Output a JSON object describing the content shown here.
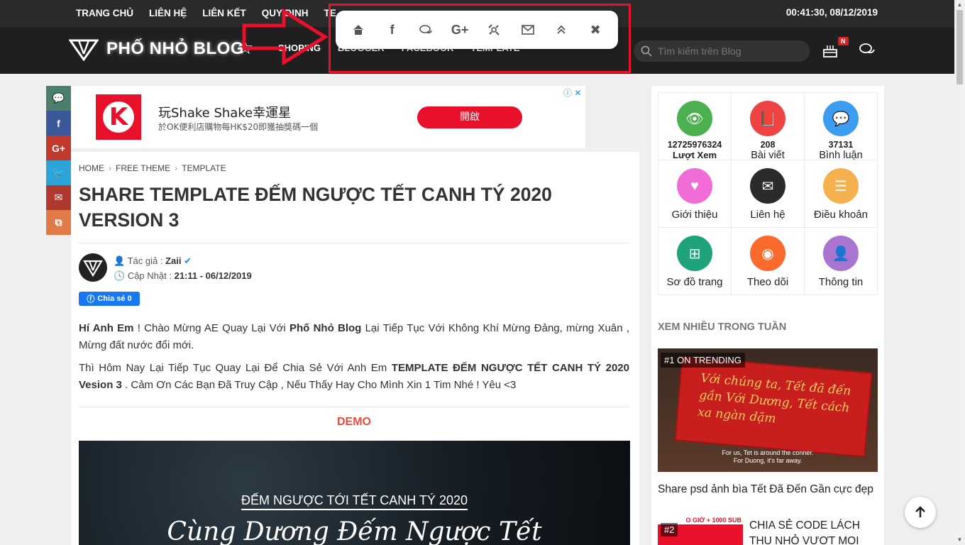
{
  "topnav": [
    "TRANG CHỦ",
    "LIÊN HỆ",
    "LIÊN KẾT",
    "QUY ĐỊNH",
    "TE"
  ],
  "clock": "00:41:30, 08/12/2019",
  "logo_text": "PHỐ NHỎ BLOG",
  "mainnav": [
    "SHOPING",
    "BLOGGER",
    "FACEBOOK",
    "TEMPLATE"
  ],
  "search_placeholder": "Tìm kiếm trên Blog",
  "notif_badge": "N",
  "side_share": [
    {
      "icon": "comment-icon",
      "glyph": "💬",
      "color": "#4a7f6b"
    },
    {
      "icon": "facebook-icon",
      "glyph": "f",
      "color": "#3b5998"
    },
    {
      "icon": "google-plus-icon",
      "glyph": "G+",
      "color": "#c0392b"
    },
    {
      "icon": "twitter-icon",
      "glyph": "🐦",
      "color": "#2da4d8"
    },
    {
      "icon": "mail-icon",
      "glyph": "✉",
      "color": "#b0392f"
    },
    {
      "icon": "copy-icon",
      "glyph": "⧉",
      "color": "#e07a48"
    }
  ],
  "ad": {
    "title": "玩Shake Shake幸運星",
    "subtitle": "於OK便利店購物每HK$20即獲抽獎碼一個",
    "button": "開啟",
    "logo_letter": "K"
  },
  "breadcrumb": [
    "HOME",
    "FREE THEME",
    "TEMPLATE"
  ],
  "article_title": "SHARE TEMPLATE ĐẾM NGƯỢC TẾT CANH TÝ 2020 VERSION 3",
  "author_label": "Tác giả :",
  "author_name": "Zaii",
  "updated_label": "Cập Nhật :",
  "updated_value": "21:11 - 06/12/2019",
  "fb_share": "Chia sẻ 0",
  "para1_bold1": "Hí Anh Em",
  "para1_mid": " ! Chào Mừng AE Quay Lại Với ",
  "para1_bold2": "Phố Nhỏ Blog",
  "para1_end": " Lại Tiếp Tục Với Không Khí Mừng Đảng, mừng Xuân , Mừng đất nước đổi mới.",
  "para2_start": "Thì Hôm Nay Lại Tiếp Tục Quay Lại Để Chia Sẻ Với Anh Em ",
  "para2_bold": "TEMPLATE ĐẾM NGƯỢC TẾT CANH TÝ 2020 Vesion 3",
  "para2_end": " . Cảm Ơn Các Bạn Đã Truy Cập , Nếu Thấy Hay Cho Mình Xin 1 Tim Nhé ! Yêu <3",
  "demo_label": "DEMO",
  "demo_heading": "ĐẾM NGƯỢC TỚI TẾT CANH TÝ 2020",
  "demo_script": "Cùng Dương Đếm Ngược Tết",
  "stats": [
    {
      "icon": "eye-icon",
      "glyph": "👁",
      "color": "#4caf50",
      "num": "12725976324",
      "label": "Lượt Xem"
    },
    {
      "icon": "book-icon",
      "glyph": "📕",
      "color": "#ef4444",
      "num": "208",
      "label": "Bài viết"
    },
    {
      "icon": "comments-icon",
      "glyph": "💬",
      "color": "#3b9cf0",
      "num": "37131",
      "label": "Bình luận"
    },
    {
      "icon": "heart-icon",
      "glyph": "♥",
      "color": "#f06dd8",
      "num": "",
      "label": "Giới thiệu"
    },
    {
      "icon": "envelope-icon",
      "glyph": "✉",
      "color": "#2b2b2b",
      "num": "",
      "label": "Liên hệ"
    },
    {
      "icon": "list-icon",
      "glyph": "☰",
      "color": "#f5b14d",
      "num": "",
      "label": "Điều khoản"
    },
    {
      "icon": "sitemap-icon",
      "glyph": "⊞",
      "color": "#1fa37a",
      "num": "",
      "label": "Sơ đồ trang"
    },
    {
      "icon": "rss-icon",
      "glyph": "◉",
      "color": "#fb6a2d",
      "num": "",
      "label": "Theo dõi"
    },
    {
      "icon": "user-icon",
      "glyph": "👤",
      "color": "#a875d0",
      "num": "",
      "label": "Thông tin"
    }
  ],
  "sidebar_title": "XEM NHIỀU TRONG TUẦN",
  "trend1_tag": "#1 ON TRENDING",
  "trend1_banner": "Với chúng ta, Tết đã đến gần Với Dương, Tết cách xa ngàn dặm",
  "trend1_sub1": "For us, Tet is around the conner.",
  "trend1_sub2": "For Duong, it's far away.",
  "trend1_title": "Share psd ảnh bìa Tết Đã Đến Gần cực đẹp",
  "trend2_tag": "#2",
  "trend2_top": "O GIỜ + 1000 SUB",
  "trend2_title": "CHIA SẺ CODE LÁCH THU NHỎ VƯỢT MỌI"
}
